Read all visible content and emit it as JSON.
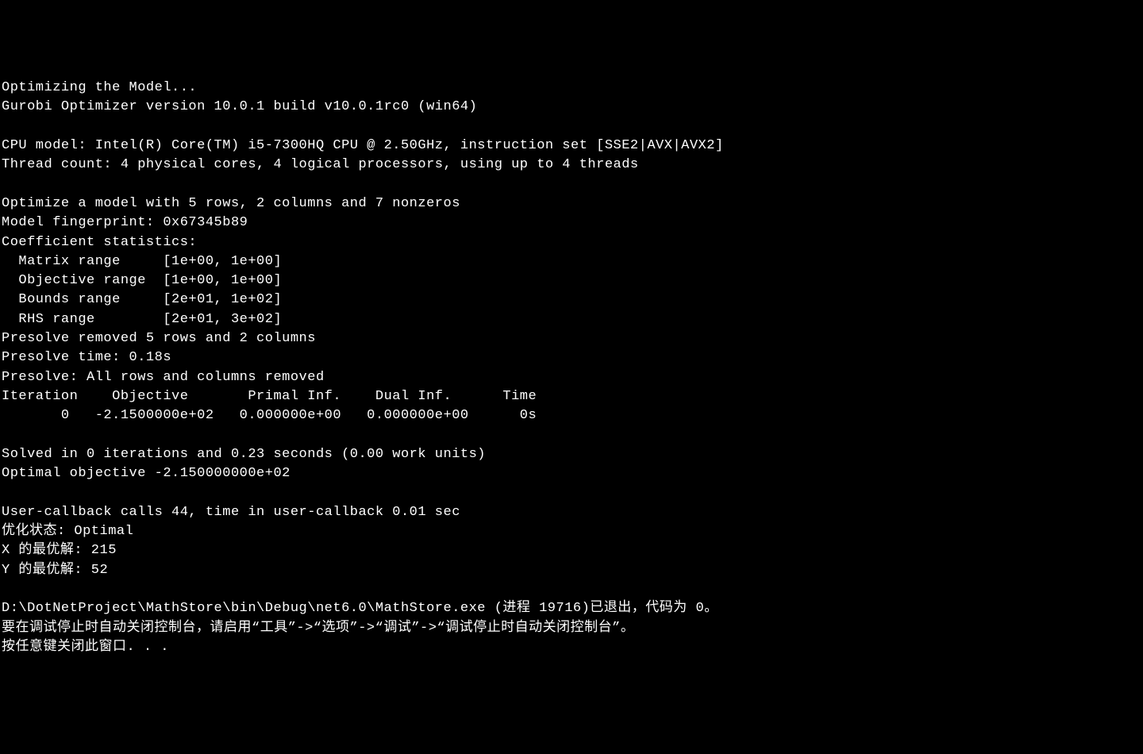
{
  "terminal": {
    "lines": [
      "Optimizing the Model...",
      "Gurobi Optimizer version 10.0.1 build v10.0.1rc0 (win64)",
      "",
      "CPU model: Intel(R) Core(TM) i5-7300HQ CPU @ 2.50GHz, instruction set [SSE2|AVX|AVX2]",
      "Thread count: 4 physical cores, 4 logical processors, using up to 4 threads",
      "",
      "Optimize a model with 5 rows, 2 columns and 7 nonzeros",
      "Model fingerprint: 0x67345b89",
      "Coefficient statistics:",
      "  Matrix range     [1e+00, 1e+00]",
      "  Objective range  [1e+00, 1e+00]",
      "  Bounds range     [2e+01, 1e+02]",
      "  RHS range        [2e+01, 3e+02]",
      "Presolve removed 5 rows and 2 columns",
      "Presolve time: 0.18s",
      "Presolve: All rows and columns removed",
      "Iteration    Objective       Primal Inf.    Dual Inf.      Time",
      "       0   -2.1500000e+02   0.000000e+00   0.000000e+00      0s",
      "",
      "Solved in 0 iterations and 0.23 seconds (0.00 work units)",
      "Optimal objective -2.150000000e+02",
      "",
      "User-callback calls 44, time in user-callback 0.01 sec",
      "优化状态: Optimal",
      "X 的最优解: 215",
      "Y 的最优解: 52",
      "",
      "D:\\DotNetProject\\MathStore\\bin\\Debug\\net6.0\\MathStore.exe (进程 19716)已退出，代码为 0。",
      "要在调试停止时自动关闭控制台，请启用“工具”->“选项”->“调试”->“调试停止时自动关闭控制台”。",
      "按任意键关闭此窗口. . ."
    ]
  }
}
